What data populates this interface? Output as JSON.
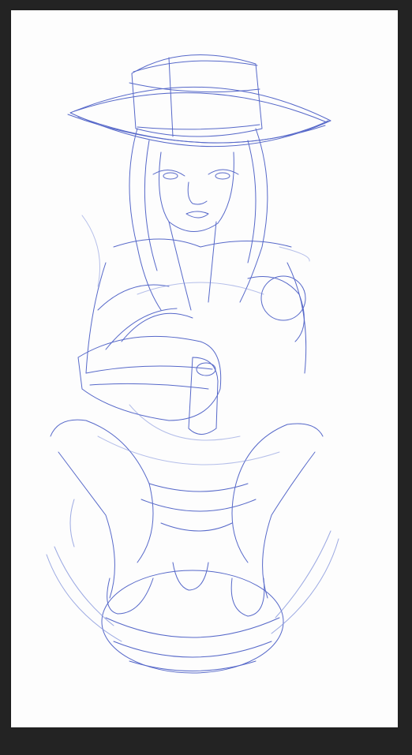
{
  "canvas": {
    "background_color": "#232323",
    "paper_color": "#fdfdfd",
    "ink_color": "#3a4fc0",
    "ink_light_color": "#6f82d6"
  },
  "artwork": {
    "subject_icon": "pencil-sketch-figure"
  }
}
